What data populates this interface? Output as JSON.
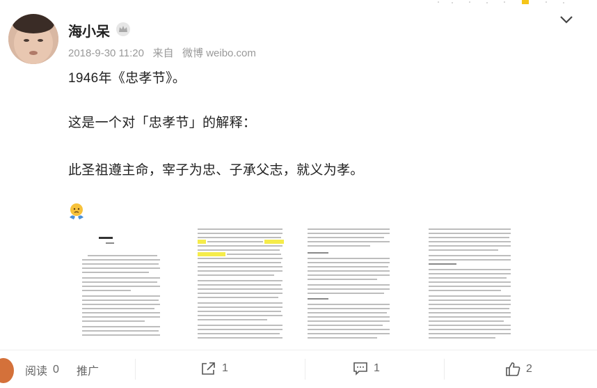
{
  "post": {
    "author": "海小呆",
    "date": "2018-9-30 11:20",
    "source_prefix": "来自",
    "source": "微博 weibo.com",
    "lines": [
      "1946年《忠孝节》。",
      "这是一个对「忠孝节」的解释：",
      "此圣祖遵主命，宰子为忠、子承父志，就义为孝。"
    ]
  },
  "icons": {
    "author_badge": "crown-badge-icon",
    "menu": "chevron-down-icon",
    "emoji": "thinking-emoji-icon",
    "repost": "share-icon",
    "comment": "comment-icon",
    "like": "thumbs-up-icon"
  },
  "footer": {
    "reads_label": "阅读",
    "reads_count": "0",
    "promote_label": "推广",
    "repost_count": "1",
    "comment_count": "1",
    "like_count": "2"
  },
  "colors": {
    "author": "#222222",
    "meta": "#999999",
    "text": "#222222",
    "footer_text": "#666666"
  }
}
